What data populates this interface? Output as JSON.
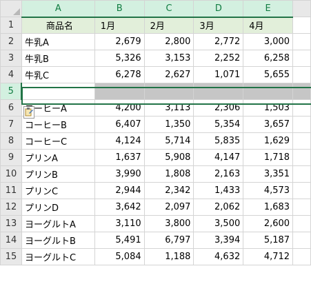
{
  "columns": [
    "A",
    "B",
    "C",
    "D",
    "E"
  ],
  "rows": [
    {
      "num": "1",
      "cells": [
        "商品名",
        "1月",
        "2月",
        "3月",
        "4月"
      ]
    },
    {
      "num": "2",
      "cells": [
        "牛乳A",
        "2,679",
        "2,800",
        "2,772",
        "3,000"
      ]
    },
    {
      "num": "3",
      "cells": [
        "牛乳B",
        "5,326",
        "3,153",
        "2,252",
        "6,258"
      ]
    },
    {
      "num": "4",
      "cells": [
        "牛乳C",
        "6,278",
        "2,627",
        "1,071",
        "5,655"
      ]
    },
    {
      "num": "5",
      "cells": [
        "",
        "",
        "",
        "",
        ""
      ]
    },
    {
      "num": "6",
      "cells": [
        "コーヒーA",
        "4,200",
        "3,113",
        "2,306",
        "1,503"
      ]
    },
    {
      "num": "7",
      "cells": [
        "コーヒーB",
        "6,407",
        "1,350",
        "5,354",
        "3,657"
      ]
    },
    {
      "num": "8",
      "cells": [
        "コーヒーC",
        "4,124",
        "5,714",
        "5,835",
        "1,629"
      ]
    },
    {
      "num": "9",
      "cells": [
        "プリンA",
        "1,637",
        "5,908",
        "4,147",
        "1,718"
      ]
    },
    {
      "num": "10",
      "cells": [
        "プリンB",
        "3,990",
        "1,808",
        "2,163",
        "3,351"
      ]
    },
    {
      "num": "11",
      "cells": [
        "プリンC",
        "2,944",
        "2,342",
        "1,433",
        "4,573"
      ]
    },
    {
      "num": "12",
      "cells": [
        "プリンD",
        "3,642",
        "2,097",
        "2,062",
        "1,683"
      ]
    },
    {
      "num": "13",
      "cells": [
        "ヨーグルトA",
        "3,110",
        "3,800",
        "3,500",
        "2,600"
      ]
    },
    {
      "num": "14",
      "cells": [
        "ヨーグルトB",
        "5,491",
        "6,797",
        "3,394",
        "5,187"
      ]
    },
    {
      "num": "15",
      "cells": [
        "ヨーグルトC",
        "5,084",
        "1,188",
        "4,632",
        "4,712"
      ]
    }
  ],
  "selected_row": "5",
  "colors": {
    "header_fill": "#e2efda",
    "selection_border": "#217346",
    "selected_fill": "#c6c6c6"
  }
}
